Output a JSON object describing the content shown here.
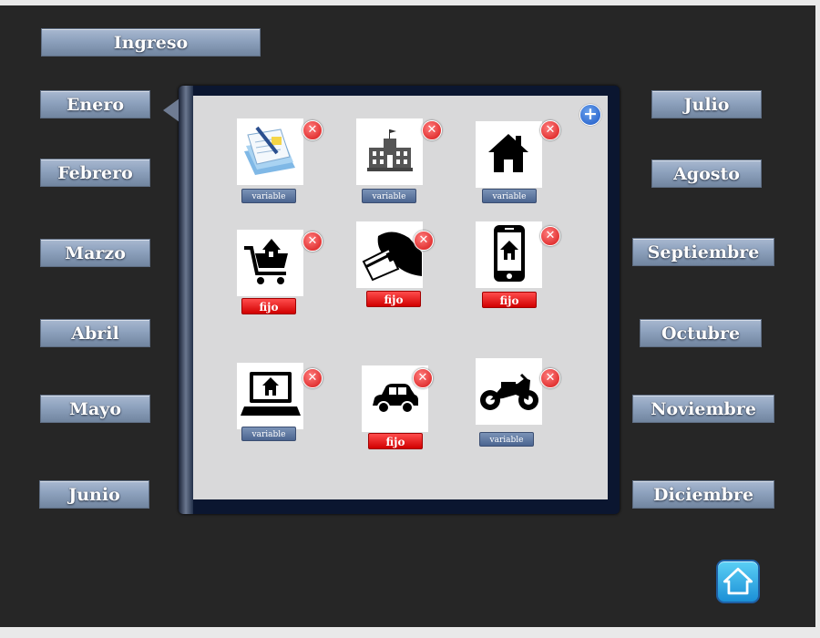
{
  "header": {
    "income_label": "Ingreso"
  },
  "months": {
    "left": [
      "Enero",
      "Febrero",
      "Marzo",
      "Abril",
      "Mayo",
      "Junio"
    ],
    "right": [
      "Julio",
      "Agosto",
      "Septiembre",
      "Octubre",
      "Noviembre",
      "Diciembre"
    ]
  },
  "panel": {
    "add_icon": "plus-circle-icon",
    "items": [
      {
        "icon": "documents-icon",
        "type": "variable"
      },
      {
        "icon": "building-icon",
        "type": "variable"
      },
      {
        "icon": "house-icon",
        "type": "variable"
      },
      {
        "icon": "cart-house-icon",
        "type": "fijo"
      },
      {
        "icon": "hand-card-icon",
        "type": "fijo"
      },
      {
        "icon": "phone-house-icon",
        "type": "fijo"
      },
      {
        "icon": "laptop-house-icon",
        "type": "variable"
      },
      {
        "icon": "car-icon",
        "type": "fijo"
      },
      {
        "icon": "motorcycle-icon",
        "type": "variable"
      }
    ]
  },
  "colors": {
    "fijo": "#e00000",
    "variable": "#5570a0",
    "accent": "#1c8fd8"
  }
}
